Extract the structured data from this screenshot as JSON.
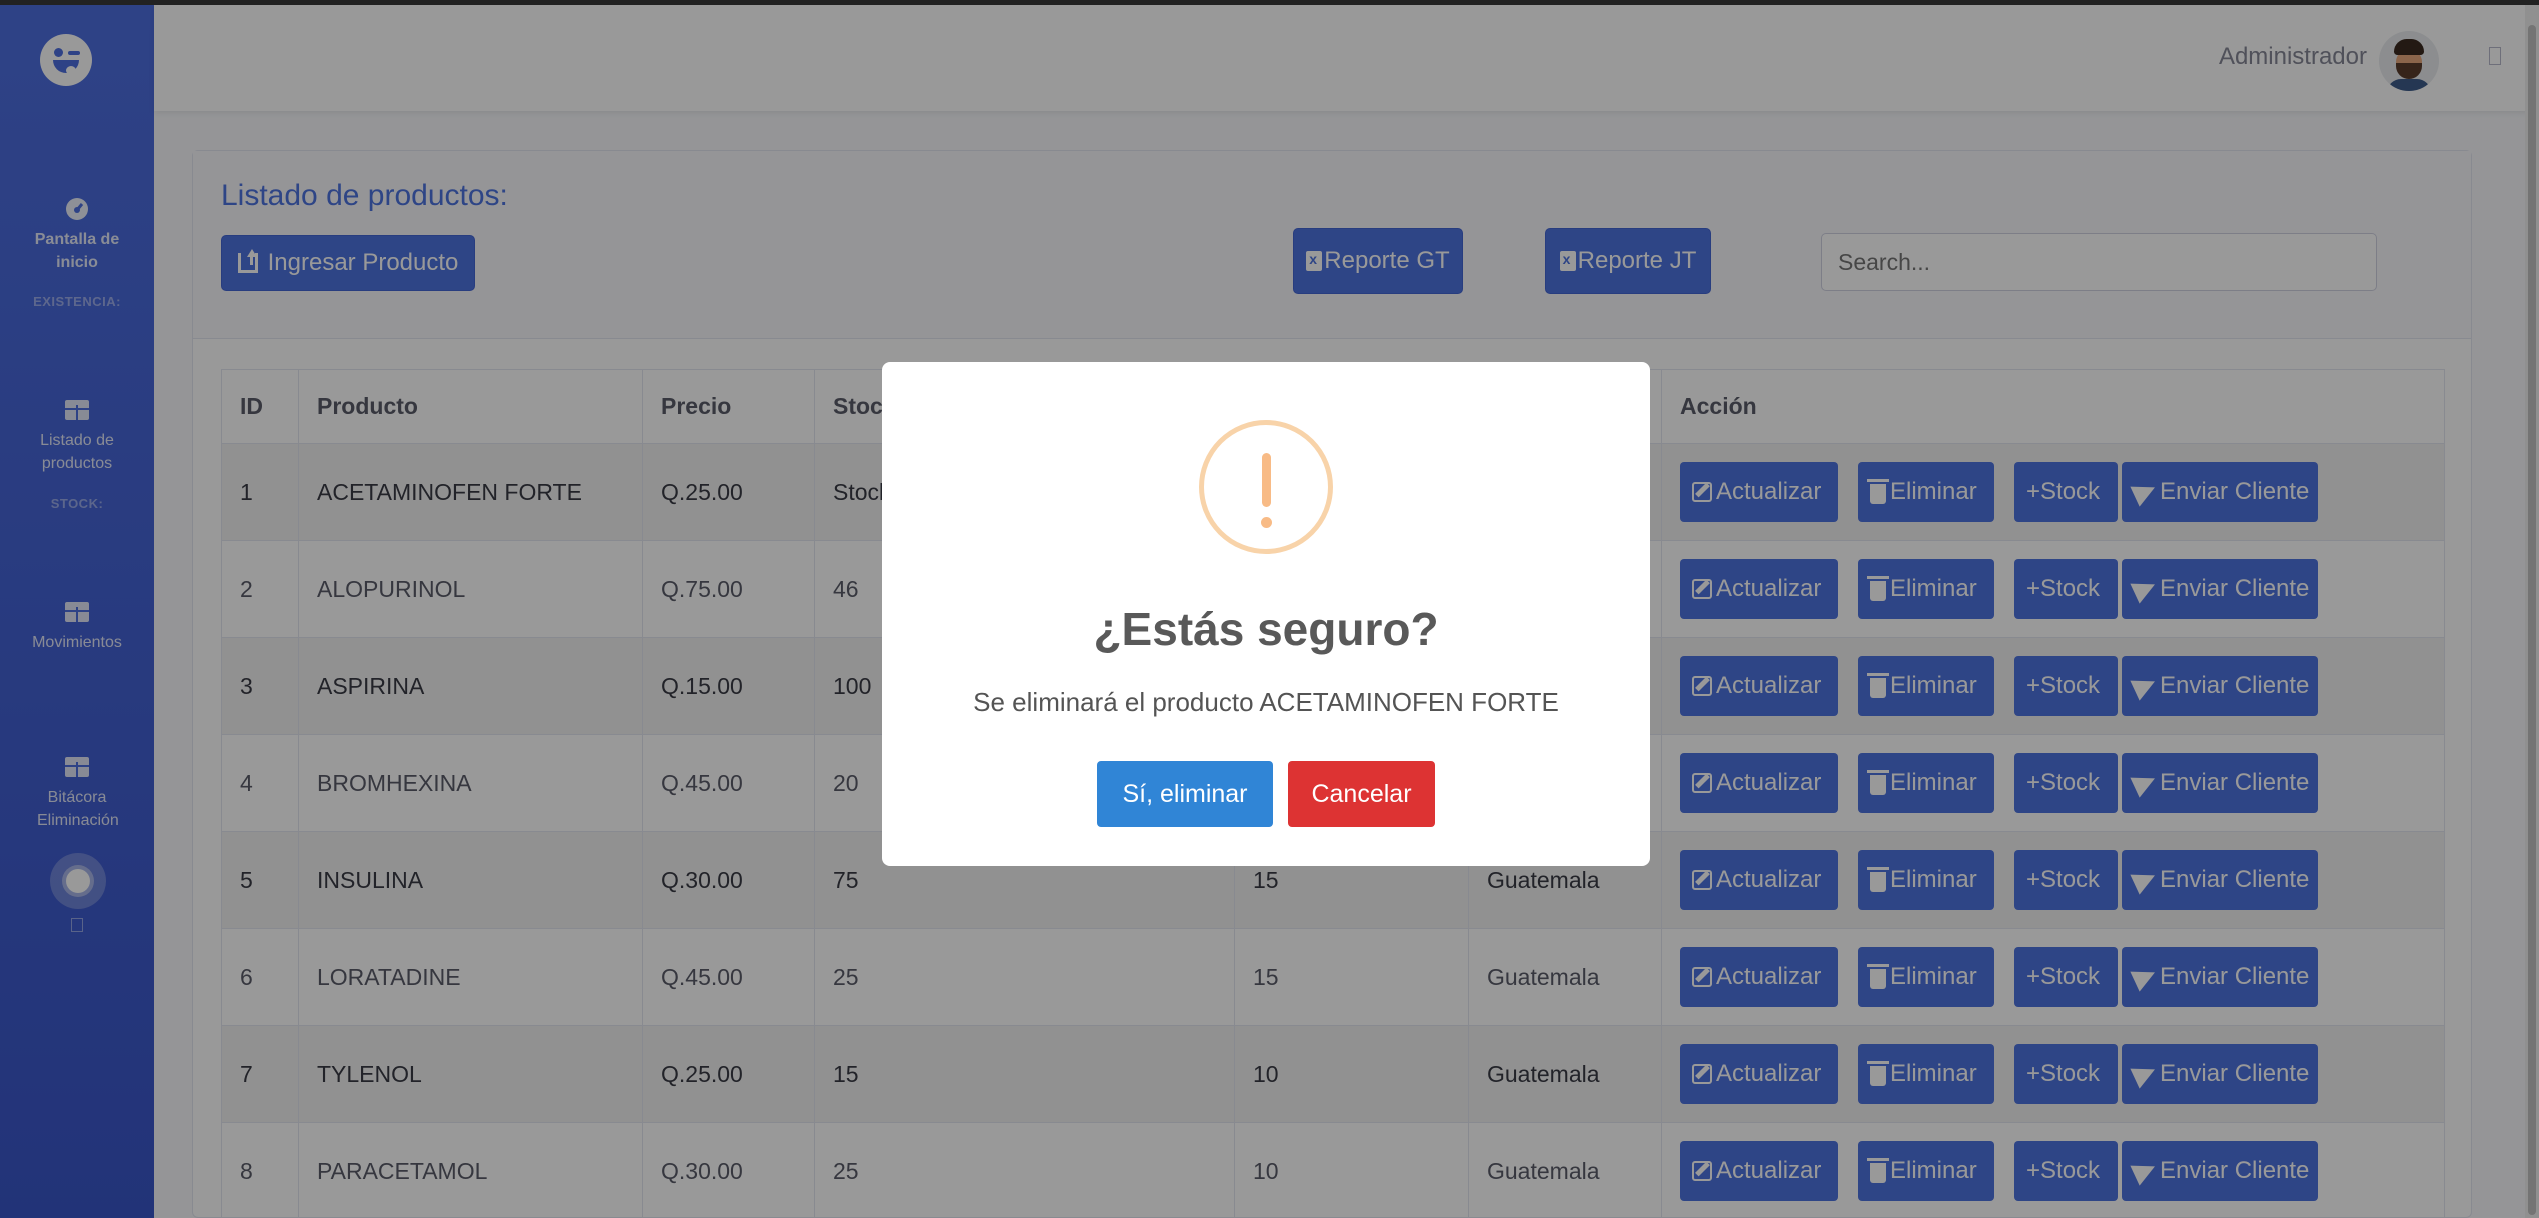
{
  "sidebar": {
    "brand_icon": "winking-face-icon",
    "items": [
      {
        "label": "Pantalla de inicio",
        "icon": "tachometer-icon"
      },
      {
        "label": "Listado de productos",
        "icon": "table-icon"
      },
      {
        "label": "Movimientos",
        "icon": "table-icon"
      },
      {
        "label": "Bitácora Eliminación",
        "icon": "table-icon"
      }
    ],
    "headings": [
      "EXISTENCIA:",
      "STOCK:"
    ]
  },
  "topbar": {
    "user_name": "Administrador"
  },
  "card": {
    "title": "Listado de productos:",
    "ingresar_label": "Ingresar Producto",
    "reporte_gt_label": "Reporte GT",
    "reporte_jt_label": "Reporte JT",
    "search_placeholder": "Search..."
  },
  "table": {
    "headers": [
      "ID",
      "Producto",
      "Precio",
      "Stock",
      "",
      "",
      "Acción"
    ],
    "rows": [
      {
        "id": "1",
        "producto": "ACETAMINOFEN FORTE",
        "precio": "Q.25.00",
        "stock": "Stock",
        "min": "",
        "region": ""
      },
      {
        "id": "2",
        "producto": "ALOPURINOL",
        "precio": "Q.75.00",
        "stock": "46",
        "min": "",
        "region": ""
      },
      {
        "id": "3",
        "producto": "ASPIRINA",
        "precio": "Q.15.00",
        "stock": "100",
        "min": "",
        "region": ""
      },
      {
        "id": "4",
        "producto": "BROMHEXINA",
        "precio": "Q.45.00",
        "stock": "20",
        "min": "",
        "region": ""
      },
      {
        "id": "5",
        "producto": "INSULINA",
        "precio": "Q.30.00",
        "stock": "75",
        "min": "15",
        "region": "Guatemala"
      },
      {
        "id": "6",
        "producto": "LORATADINE",
        "precio": "Q.45.00",
        "stock": "25",
        "min": "15",
        "region": "Guatemala"
      },
      {
        "id": "7",
        "producto": "TYLENOL",
        "precio": "Q.25.00",
        "stock": "15",
        "min": "10",
        "region": "Guatemala"
      },
      {
        "id": "8",
        "producto": "PARACETAMOL",
        "precio": "Q.30.00",
        "stock": "25",
        "min": "10",
        "region": "Guatemala"
      }
    ],
    "actions": {
      "update": "Actualizar",
      "delete": "Eliminar",
      "stock": "+Stock",
      "send": "Enviar Cliente"
    }
  },
  "modal": {
    "title": "¿Estás seguro?",
    "text": "Se eliminará el producto ACETAMINOFEN FORTE",
    "confirm_label": "Sí, eliminar",
    "cancel_label": "Cancelar",
    "icon": "warning-icon"
  },
  "colors": {
    "primary": "#4e73df",
    "danger": "#e74a3b",
    "confirm": "#3085d6",
    "cancel": "#dd3333",
    "warning": "#f8bb86"
  }
}
